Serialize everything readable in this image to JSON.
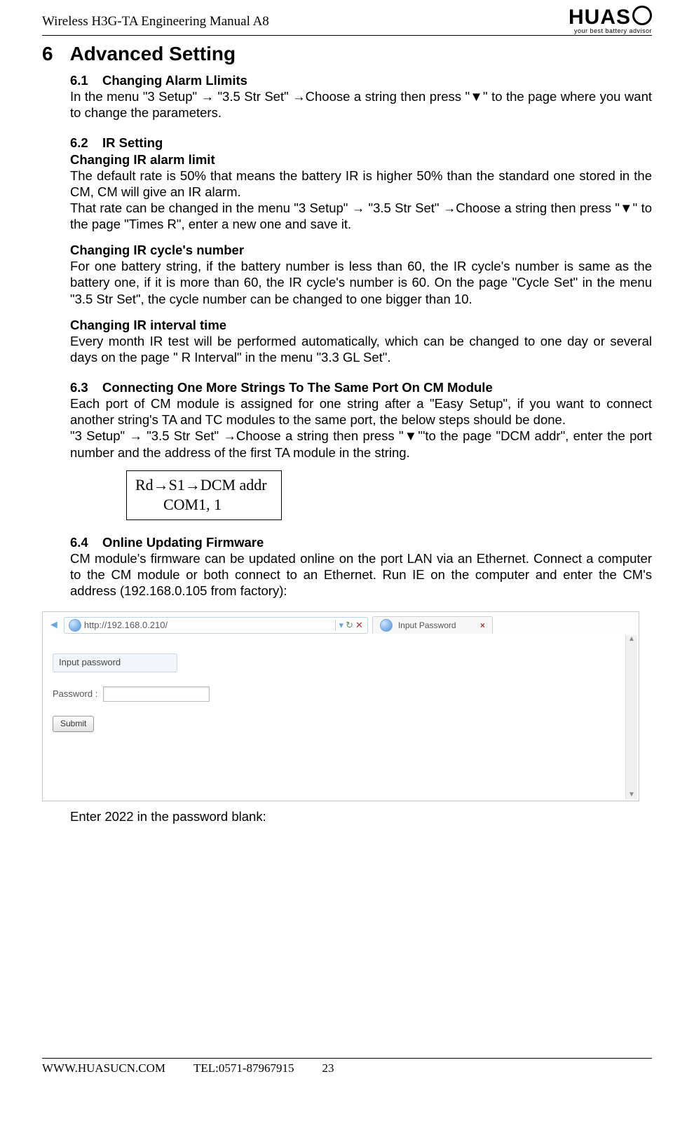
{
  "header": {
    "doc_title": "Wireless H3G-TA Engineering Manual A8",
    "logo_text": "HUAS",
    "logo_tagline": "your best battery advisor"
  },
  "section": {
    "number": "6",
    "title": "Advanced Setting"
  },
  "s61": {
    "num": "6.1",
    "title": "Changing Alarm Llimits",
    "body": "In the menu \"3 Setup\" → \"3.5 Str Set\" →Choose a string then press \"▼\" to the page where you want to change the parameters."
  },
  "s62": {
    "num": "6.2",
    "title": "IR Setting",
    "h1": "Changing IR alarm limit",
    "p1": "The default rate is 50% that means the battery IR is higher 50% than the standard one stored in the CM, CM will give an IR alarm.",
    "p2": "That rate can be changed in the menu \"3 Setup\" → \"3.5 Str Set\" →Choose a string then press \"▼\" to the page \"Times R\", enter a new one and save it.",
    "h2": "Changing IR cycle's number",
    "p3": "For one battery string, if the battery number is less than 60, the IR cycle's number is same as the battery one, if it is more than 60, the IR cycle's number is 60. On the page \"Cycle Set\" in the menu   \"3.5 Str Set\", the cycle number can be changed to one bigger than 10.",
    "h3": "Changing IR interval time",
    "p4": "Every month IR test will be performed automatically, which can be changed to one day or several days on the page \" R Interval\" in the menu \"3.3 GL Set\"."
  },
  "s63": {
    "num": "6.3",
    "title": "Connecting One More Strings To The Same Port On CM Module",
    "p1": "Each port of CM module is assigned for one string after a \"Easy Setup\", if you want to connect another string's TA and TC modules to the same port, the below steps should be done.",
    "p2": "\"3 Setup\" → \"3.5 Str Set\" →Choose a string then press \"▼'\"to the page \"DCM addr\", enter the port number and the address of the first TA module in the string.",
    "box_l1": "Rd→S1→DCM addr",
    "box_l2": "COM1, 1"
  },
  "s64": {
    "num": "6.4",
    "title": "Online Updating Firmware",
    "p1": "CM module's firmware can be updated online on the port LAN via an Ethernet. Connect a computer to the CM module or both connect to an Ethernet. Run IE on the computer and enter the CM's address (192.168.0.105 from factory):",
    "p2": "Enter 2022 in the password blank:"
  },
  "browser": {
    "url": "http://192.168.0.210/",
    "tab_title": "Input Password",
    "panel_title": "Input password",
    "password_label": "Password :",
    "submit": "Submit"
  },
  "footer": {
    "site": "WWW.HUASUCN.COM",
    "tel": "TEL:0571-87967915",
    "page": "23"
  }
}
